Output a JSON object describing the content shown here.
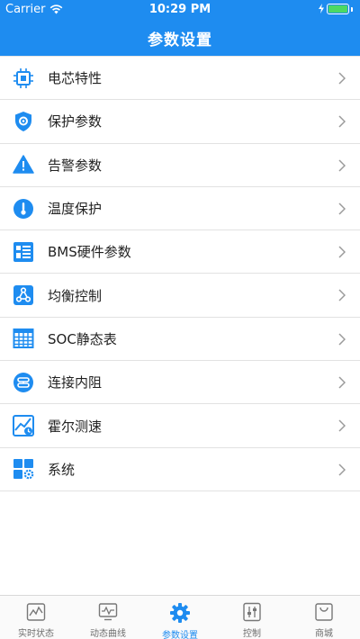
{
  "status_bar": {
    "carrier": "Carrier",
    "time": "10:29 PM"
  },
  "header": {
    "title": "参数设置"
  },
  "list": {
    "items": [
      {
        "label": "电芯特性",
        "icon": "chip-icon"
      },
      {
        "label": "保护参数",
        "icon": "shield-gear-icon"
      },
      {
        "label": "告警参数",
        "icon": "warning-icon"
      },
      {
        "label": "温度保护",
        "icon": "thermometer-icon"
      },
      {
        "label": "BMS硬件参数",
        "icon": "hardware-list-icon"
      },
      {
        "label": "均衡控制",
        "icon": "balance-nodes-icon"
      },
      {
        "label": "SOC静态表",
        "icon": "table-grid-icon"
      },
      {
        "label": "连接内阻",
        "icon": "connection-resistance-icon"
      },
      {
        "label": "霍尔测速",
        "icon": "hall-speed-icon"
      },
      {
        "label": "系统",
        "icon": "system-grid-icon"
      }
    ]
  },
  "tabs": [
    {
      "label": "实时状态",
      "icon": "realtime-status-icon",
      "active": false
    },
    {
      "label": "动态曲线",
      "icon": "dynamic-curve-icon",
      "active": false
    },
    {
      "label": "参数设置",
      "icon": "settings-gear-icon",
      "active": true
    },
    {
      "label": "控制",
      "icon": "control-sliders-icon",
      "active": false
    },
    {
      "label": "商城",
      "icon": "shopping-bag-icon",
      "active": false
    }
  ],
  "colors": {
    "accent": "#1e8cf0",
    "inactive": "#6d6d6d",
    "battery": "#4cd964"
  }
}
